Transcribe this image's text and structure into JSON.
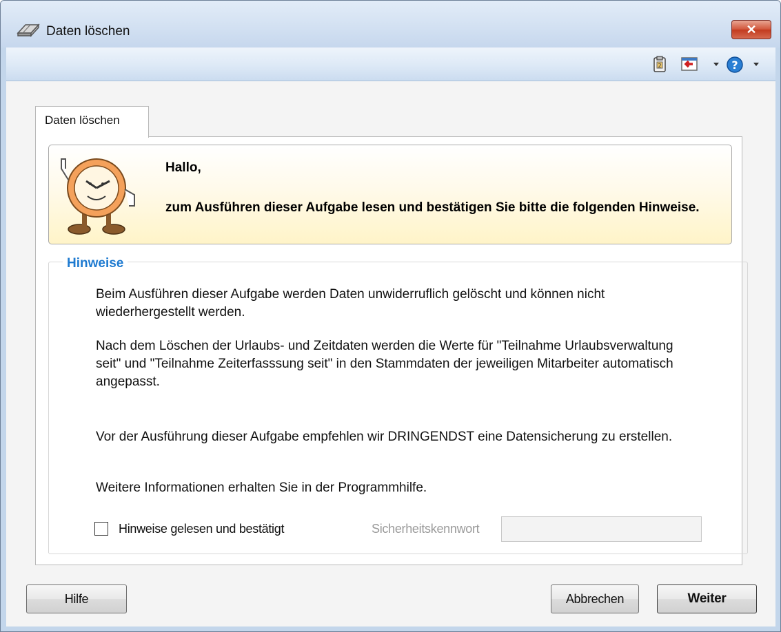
{
  "window": {
    "title": "Daten löschen",
    "close_label": "✕"
  },
  "toolbar": {
    "icons": [
      "clipboard-icon",
      "exit-icon",
      "dropdown-arrow-icon",
      "help-icon",
      "dropdown-arrow-icon"
    ]
  },
  "tab": {
    "label": "Daten löschen"
  },
  "banner": {
    "greeting": "Hallo,",
    "message": "zum Ausführen dieser Aufgabe lesen und bestätigen Sie bitte die folgenden Hinweise."
  },
  "hinweise": {
    "title": "Hinweise",
    "paragraphs": [
      "Beim Ausführen dieser Aufgabe werden Daten unwiderruflich gelöscht und können nicht wiederhergestellt werden.",
      "Nach dem Löschen der Urlaubs- und Zeitdaten werden die Werte für \"Teilnahme Urlaubsverwaltung seit\" und \"Teilnahme Zeiterfasssung seit\" in den Stammdaten der jeweiligen Mitarbeiter automatisch angepasst.",
      "Vor der Ausführung dieser Aufgabe empfehlen wir DRINGENDST eine Datensicherung zu erstellen.",
      "Weitere Informationen erhalten Sie in der Programmhilfe."
    ],
    "checkbox_label": "Hinweise gelesen und bestätigt",
    "checkbox_checked": false,
    "password_label": "Sicherheitskennwort",
    "password_value": ""
  },
  "buttons": {
    "help": "Hilfe",
    "cancel": "Abbrechen",
    "next": "Weiter"
  },
  "colors": {
    "accent": "#1e7ad0",
    "close": "#c9432a",
    "banner": "#fff4c8"
  }
}
